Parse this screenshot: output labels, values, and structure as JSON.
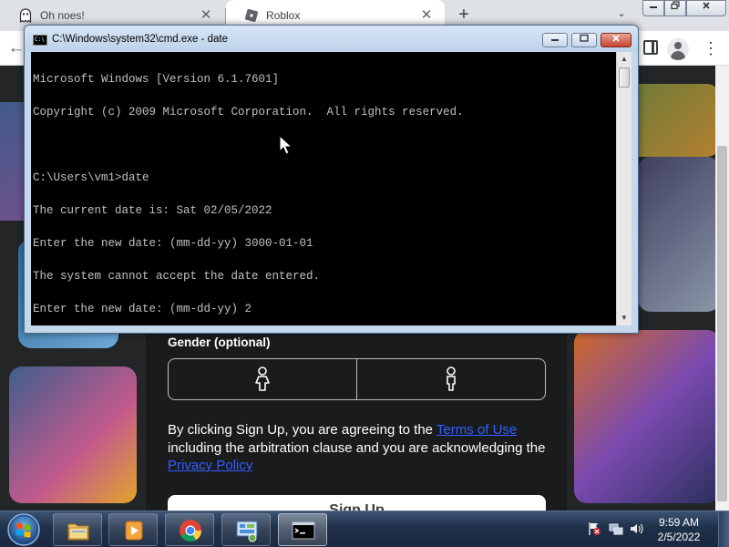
{
  "browser": {
    "tabs": [
      {
        "title": "Oh noes!",
        "icon": "ghost-icon"
      },
      {
        "title": "Roblox",
        "icon": "roblox-icon"
      }
    ],
    "new_tab_symbol": "+",
    "tab_close_symbol": "✕",
    "tab_search_symbol": "⌄",
    "back_symbol": "←",
    "menu_symbol": "⋮"
  },
  "page": {
    "gender_label": "Gender (optional)",
    "legal": {
      "part1": "By clicking Sign Up, you are agreeing to the ",
      "terms_link": "Terms of Use",
      "part2": " including the arbitration clause and you are acknowledging the ",
      "privacy_link": "Privacy Policy"
    },
    "signup_button": "Sign Up"
  },
  "cmd": {
    "title": "C:\\Windows\\system32\\cmd.exe - date",
    "icon_text": "C:\\",
    "lines": [
      "Microsoft Windows [Version 6.1.7601]",
      "Copyright (c) 2009 Microsoft Corporation.  All rights reserved.",
      "",
      "C:\\Users\\vm1>date",
      "The current date is: Sat 02/05/2022",
      "Enter the new date: (mm-dd-yy) 3000-01-01",
      "The system cannot accept the date entered.",
      "Enter the new date: (mm-dd-yy) 2"
    ]
  },
  "taskbar": {
    "items": [
      "explorer-icon",
      "media-player-icon",
      "chrome-icon",
      "control-panel-icon",
      "cmd-icon"
    ],
    "active": "cmd-icon",
    "clock_time": "9:59 AM",
    "clock_date": "2/5/2022"
  },
  "colors": {
    "link": "#335fff",
    "console_bg": "#000000",
    "console_text": "#c0c0c0",
    "page_bg": "#191b1d"
  }
}
